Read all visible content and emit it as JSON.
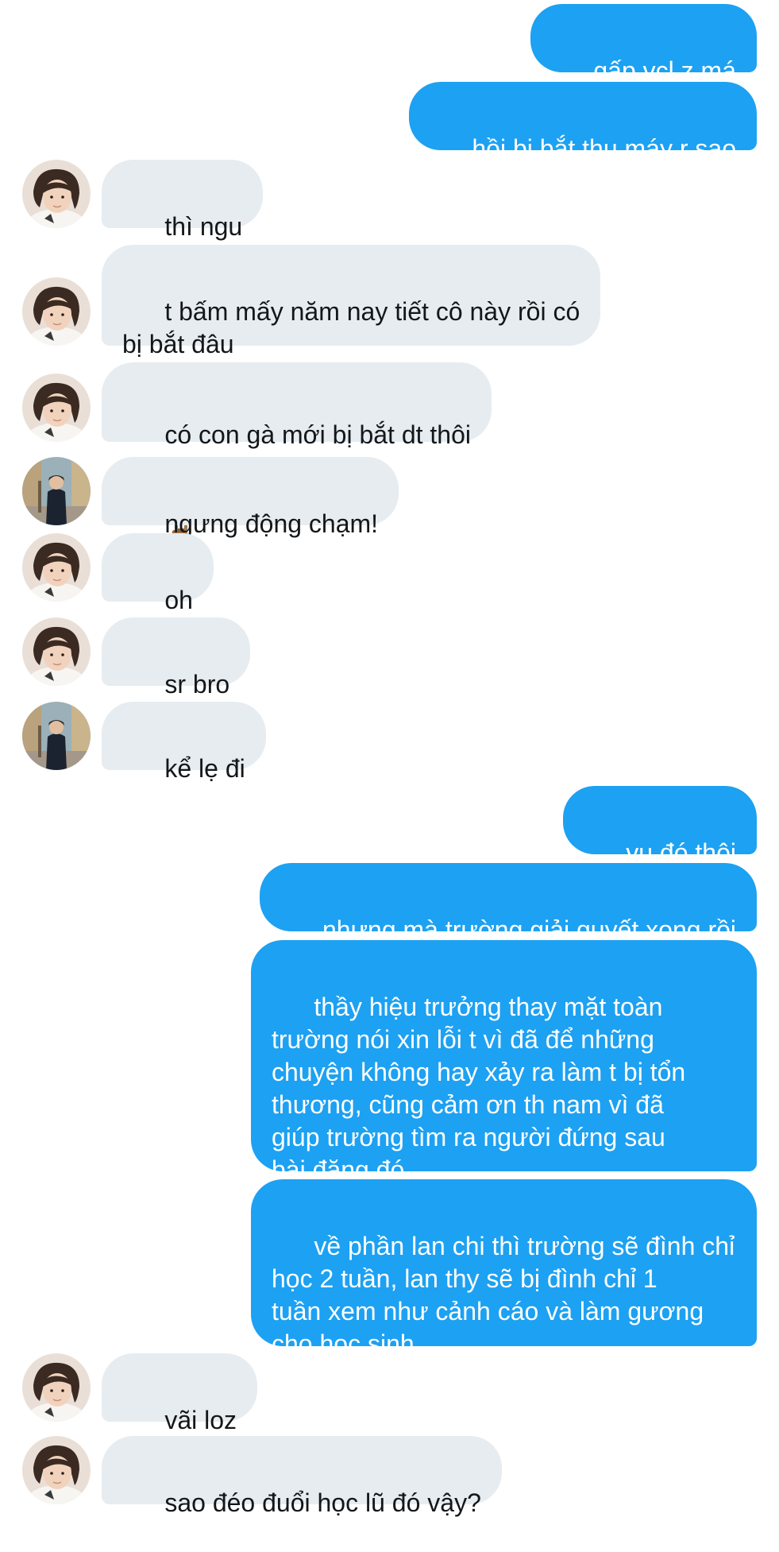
{
  "conversation": {
    "messages": [
      {
        "side": "out",
        "text": "gấp vcl z má"
      },
      {
        "side": "out",
        "text": "hồi bị bắt thu máy r sao"
      },
      {
        "side": "in",
        "avatar": "avatar-a",
        "text": "thì ngu"
      },
      {
        "side": "in",
        "avatar": "avatar-a",
        "text": "t bấm mấy năm nay tiết cô này rồi có\nbị bắt đâu"
      },
      {
        "side": "in",
        "avatar": "avatar-a",
        "text": "có con gà mới bị bắt dt thôi",
        "emoji": [
          "rock-on-hand-icon",
          "rock-on-hand-icon"
        ]
      },
      {
        "side": "in",
        "avatar": "avatar-b",
        "text": "ngưng động chạm!"
      },
      {
        "side": "in",
        "avatar": "avatar-a",
        "text": "oh"
      },
      {
        "side": "in",
        "avatar": "avatar-a",
        "text": "sr bro"
      },
      {
        "side": "in",
        "avatar": "avatar-b",
        "text": "kể lẹ đi"
      },
      {
        "side": "out",
        "text": "vụ đó thôi"
      },
      {
        "side": "out",
        "text": "nhưng mà trường giải quyết xong rồi"
      },
      {
        "side": "out",
        "text": "thầy hiệu trưởng thay mặt toàn\ntrường nói xin lỗi t vì đã để những\nchuyện không hay xảy ra làm t bị tổn\nthương, cũng cảm ơn th nam vì đã\ngiúp trường tìm ra người đứng sau\nbài đăng đó"
      },
      {
        "side": "out",
        "text": "về phần lan chi thì trường sẽ đình chỉ\nhọc 2 tuần, lan thy sẽ bị đình chỉ 1\ntuần xem như cảnh cáo và làm gương\ncho học sinh"
      },
      {
        "side": "in",
        "avatar": "avatar-a",
        "text": "vãi loz"
      },
      {
        "side": "in",
        "avatar": "avatar-a",
        "text": "sao đéo đuổi học lũ đó vậy?"
      }
    ]
  },
  "colors": {
    "outgoing_bubble": "#1da1f2",
    "incoming_bubble": "#e6ecf0",
    "outgoing_text": "#ffffff",
    "incoming_text": "#14171a"
  }
}
